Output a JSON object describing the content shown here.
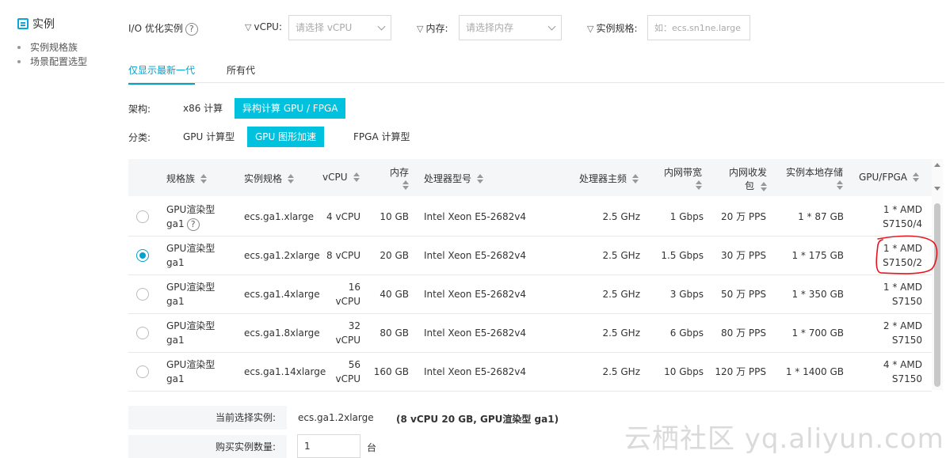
{
  "sidebar": {
    "title": "实例",
    "items": [
      {
        "label": "实例规格族"
      },
      {
        "label": "场景配置选型"
      }
    ]
  },
  "filters": {
    "io_label": "I/O 优化实例",
    "help_glyph": "?",
    "vcpu_label": "vCPU:",
    "vcpu_placeholder": "请选择 vCPU",
    "mem_label": "内存:",
    "mem_placeholder": "请选择内存",
    "spec_label": "实例规格:",
    "spec_placeholder": "如：ecs.sn1ne.large"
  },
  "generation_tabs": [
    {
      "label": "仅显示最新一代",
      "active": true
    },
    {
      "label": "所有代",
      "active": false
    }
  ],
  "architecture": {
    "label": "架构:",
    "options": [
      {
        "label": "x86 计算",
        "active": false
      },
      {
        "label": "异构计算 GPU / FPGA",
        "active": true
      }
    ]
  },
  "category": {
    "label": "分类:",
    "options": [
      {
        "label": "GPU 计算型",
        "active": false
      },
      {
        "label": "GPU 图形加速",
        "active": true
      },
      {
        "label": "FPGA 计算型",
        "active": false
      }
    ]
  },
  "table": {
    "headers": {
      "family": "规格族",
      "spec": "实例规格",
      "vcpu": "vCPU",
      "memory": "内存",
      "processor": "处理器型号",
      "frequency": "处理器主频",
      "bandwidth": "内网带宽",
      "pps_line1": "内网收发",
      "pps_line2": "包",
      "storage": "实例本地存储",
      "gpu": "GPU/FPGA"
    },
    "rows": [
      {
        "family_l1": "GPU渲染型",
        "family_l2": "ga1",
        "has_help": true,
        "spec": "ecs.ga1.xlarge",
        "vcpu_l1": "4 vCPU",
        "vcpu_l2": "",
        "memory": "10 GB",
        "processor": "Intel Xeon E5-2682v4",
        "frequency": "2.5 GHz",
        "bandwidth": "1 Gbps",
        "pps": "20 万 PPS",
        "storage": "1 * 87 GB",
        "gpu_l1": "1 * AMD",
        "gpu_l2": "S7150/4",
        "selected": false
      },
      {
        "family_l1": "GPU渲染型",
        "family_l2": "ga1",
        "has_help": false,
        "spec": "ecs.ga1.2xlarge",
        "vcpu_l1": "8 vCPU",
        "vcpu_l2": "",
        "memory": "20 GB",
        "processor": "Intel Xeon E5-2682v4",
        "frequency": "2.5 GHz",
        "bandwidth": "1.5 Gbps",
        "pps": "30 万 PPS",
        "storage": "1 * 175 GB",
        "gpu_l1": "1 * AMD",
        "gpu_l2": "S7150/2",
        "selected": true
      },
      {
        "family_l1": "GPU渲染型",
        "family_l2": "ga1",
        "has_help": false,
        "spec": "ecs.ga1.4xlarge",
        "vcpu_l1": "16",
        "vcpu_l2": "vCPU",
        "memory": "40 GB",
        "processor": "Intel Xeon E5-2682v4",
        "frequency": "2.5 GHz",
        "bandwidth": "3 Gbps",
        "pps": "50 万 PPS",
        "storage": "1 * 350 GB",
        "gpu_l1": "1 * AMD",
        "gpu_l2": "S7150",
        "selected": false
      },
      {
        "family_l1": "GPU渲染型",
        "family_l2": "ga1",
        "has_help": false,
        "spec": "ecs.ga1.8xlarge",
        "vcpu_l1": "32",
        "vcpu_l2": "vCPU",
        "memory": "80 GB",
        "processor": "Intel Xeon E5-2682v4",
        "frequency": "2.5 GHz",
        "bandwidth": "6 Gbps",
        "pps": "80 万 PPS",
        "storage": "1 * 700 GB",
        "gpu_l1": "2 * AMD",
        "gpu_l2": "S7150",
        "selected": false
      },
      {
        "family_l1": "GPU渲染型",
        "family_l2": "ga1",
        "has_help": false,
        "spec": "ecs.ga1.14xlarge",
        "vcpu_l1": "56",
        "vcpu_l2": "vCPU",
        "memory": "160 GB",
        "processor": "Intel Xeon E5-2682v4",
        "frequency": "2.5 GHz",
        "bandwidth": "10 Gbps",
        "pps": "120 万 PPS",
        "storage": "1 * 1400 GB",
        "gpu_l1": "4 * AMD",
        "gpu_l2": "S7150",
        "selected": false
      }
    ]
  },
  "summary": {
    "current_label": "当前选择实例:",
    "current_spec": "ecs.ga1.2xlarge",
    "current_detail": "(8 vCPU 20 GB, GPU渲染型 ga1)",
    "qty_label": "购买实例数量:",
    "qty_value": "1",
    "qty_unit": "台"
  },
  "watermark": "云栖社区 yq.aliyun.com",
  "colors": {
    "accent": "#00c1de",
    "link": "#00a2ca",
    "annotation": "#e8141c"
  }
}
